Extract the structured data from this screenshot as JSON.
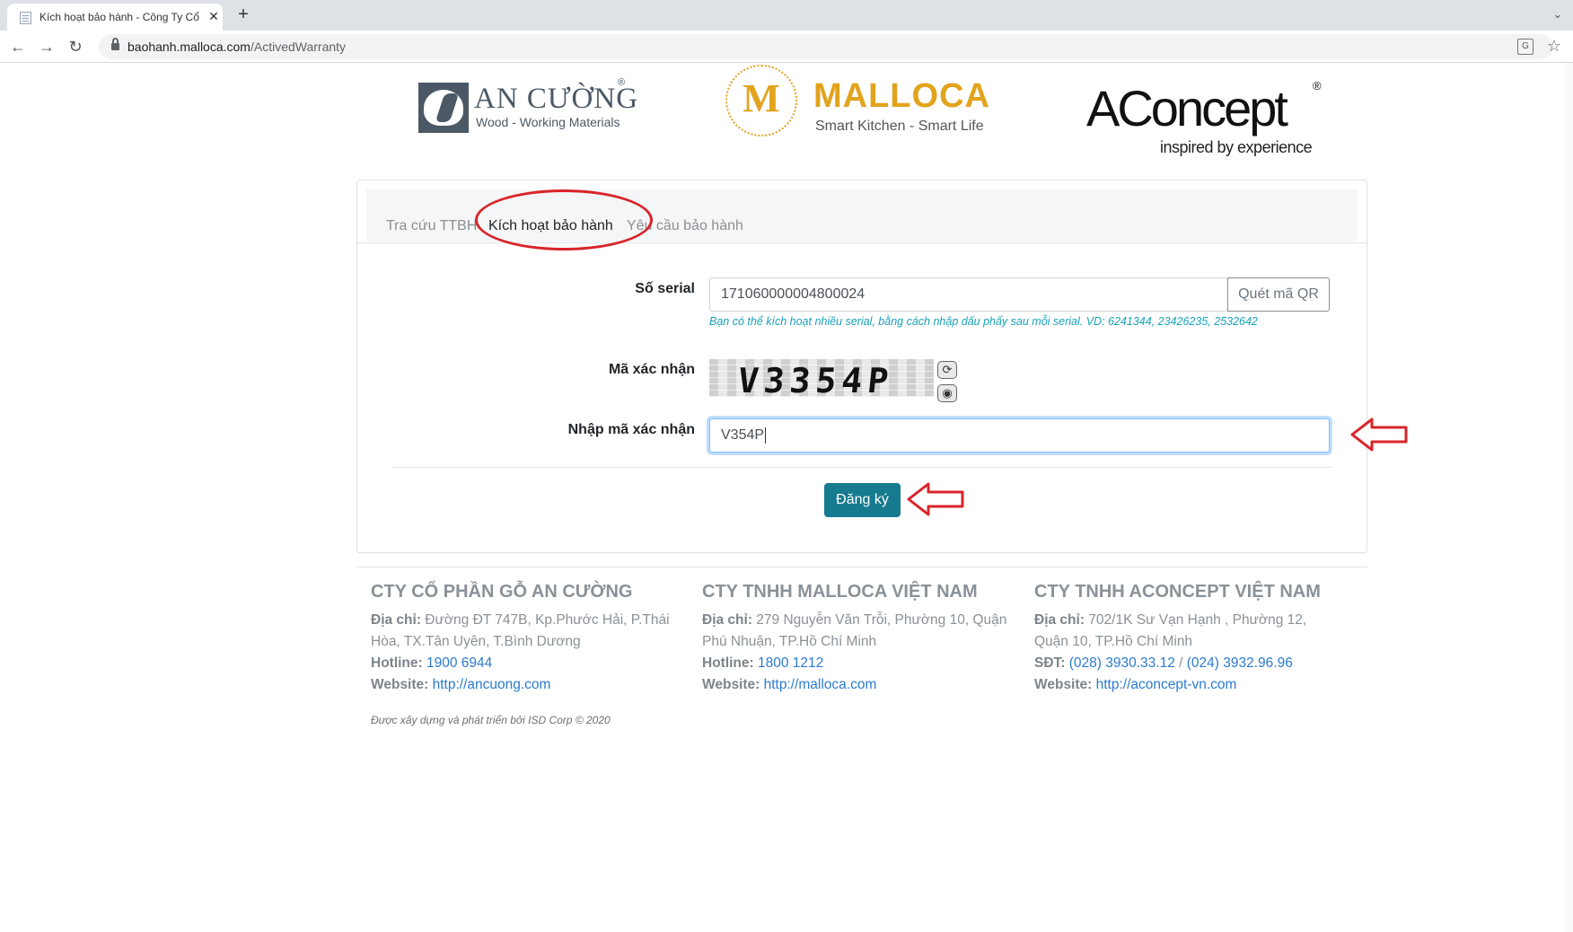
{
  "browser": {
    "tab_title": "Kích hoạt bảo hành - Công Ty Cổ",
    "url_host": "baohanh.malloca.com",
    "url_path": "/ActivedWarranty"
  },
  "logos": {
    "ancuong_name": "AN CƯỜNG",
    "ancuong_reg": "®",
    "ancuong_tagline": "Wood - Working Materials",
    "malloca_mark": "M",
    "malloca_name": "MALLOCA",
    "malloca_tagline": "Smart Kitchen - Smart Life",
    "aconcept_name": "AConcept",
    "aconcept_reg": "®",
    "aconcept_tagline": "inspired by experience"
  },
  "tabs": [
    {
      "label": "Tra cứu TTBH",
      "active": false
    },
    {
      "label": "Kích hoạt bảo hành",
      "active": true
    },
    {
      "label": "Yêu cầu bảo hành",
      "active": false
    }
  ],
  "form": {
    "serial_label": "Số serial",
    "serial_value": "171060000004800024",
    "qr_button": "Quét mã QR",
    "serial_hint": "Bạn có thể kích hoạt nhiều serial, bằng cách nhập dấu phẩy sau mỗi serial. VD: 6241344, 23426235, 2532642",
    "captcha_label": "Mã xác nhận",
    "captcha_image_text": "V3354P",
    "captcha_input_label": "Nhập mã xác nhận",
    "captcha_input_value": "V354P",
    "submit_label": "Đăng ký"
  },
  "footer": {
    "columns": [
      {
        "title": "CTY CỔ PHẦN GỖ AN CƯỜNG",
        "address_label": "Địa chỉ:",
        "address": " Đường ĐT 747B, Kp.Phước Hải, P.Thái Hòa, TX.Tân Uyên, T.Bình Dương",
        "phone_label": "Hotline:",
        "phone": "1900 6944",
        "website_label": "Website:",
        "website": "http://ancuong.com"
      },
      {
        "title": "CTY TNHH MALLOCA VIỆT NAM",
        "address_label": "Địa chỉ:",
        "address": " 279 Nguyễn Văn Trỗi, Phường 10, Quận Phú Nhuận, TP.Hồ Chí Minh",
        "phone_label": "Hotline:",
        "phone": "1800 1212",
        "website_label": "Website:",
        "website": "http://malloca.com"
      },
      {
        "title": "CTY TNHH ACONCEPT VIỆT NAM",
        "address_label": "Địa chỉ:",
        "address": " 702/1K Sư Vạn Hạnh , Phường 12, Quận 10, TP.Hồ Chí Minh",
        "phone_label": "SĐT:",
        "phone": "(028) 3930.33.12",
        "phone_sep": " / ",
        "phone2": "(024) 3932.96.96",
        "website_label": "Website:",
        "website": "http://aconcept-vn.com"
      }
    ],
    "copyright": "Được xây dựng và phát triển bởi ISD Corp © 2020"
  },
  "colors": {
    "primary_button": "#167b8f",
    "hint_text": "#17a2b8",
    "link": "#2b7bd0",
    "annotation_red": "#d9242a",
    "malloca_gold": "#e2a31d"
  }
}
